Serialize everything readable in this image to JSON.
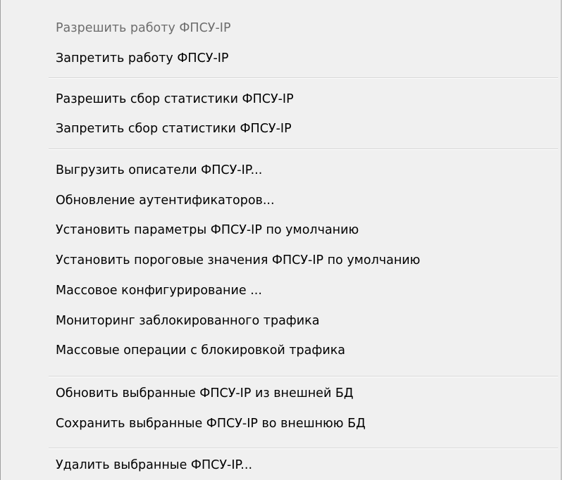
{
  "context_menu": {
    "groups": [
      {
        "items": [
          {
            "label": "Разрешить работу ФПСУ-IP",
            "disabled": true
          },
          {
            "label": "Запретить работу ФПСУ-IP",
            "disabled": false
          }
        ]
      },
      {
        "items": [
          {
            "label": "Разрешить сбор статистики ФПСУ-IP",
            "disabled": false
          },
          {
            "label": "Запретить сбор статистики ФПСУ-IP",
            "disabled": false
          }
        ]
      },
      {
        "items": [
          {
            "label": "Выгрузить описатели ФПСУ-IP...",
            "disabled": false
          },
          {
            "label": "Обновление  аутентификаторов...",
            "disabled": false
          },
          {
            "label": "Установить параметры ФПСУ-IP по умолчанию",
            "disabled": false
          },
          {
            "label": "Установить пороговые значения ФПСУ-IP по умолчанию",
            "disabled": false
          },
          {
            "label": "Массовое конфигурирование ...",
            "disabled": false
          },
          {
            "label": "Мониторинг заблокированного трафика",
            "disabled": false
          },
          {
            "label": "Массовые операции с блокировкой трафика",
            "disabled": false
          }
        ]
      },
      {
        "items": [
          {
            "label": "Обновить выбранные ФПСУ-IP из внешней БД",
            "disabled": false
          },
          {
            "label": "Сохранить выбранные ФПСУ-IP во внешнюю БД",
            "disabled": false
          }
        ]
      },
      {
        "items": [
          {
            "label": "Удалить выбранные ФПСУ-IP...",
            "disabled": false
          }
        ]
      }
    ]
  }
}
